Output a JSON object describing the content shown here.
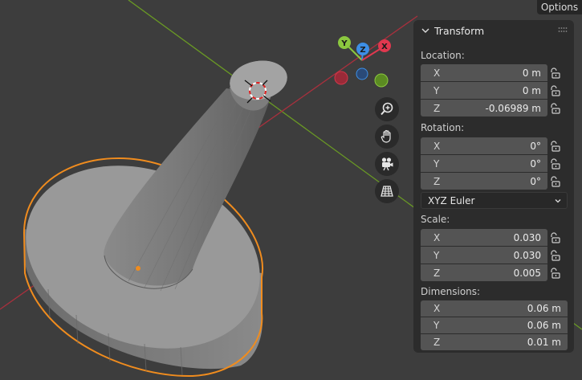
{
  "options_label": "Options",
  "gizmo": {
    "axes": [
      "Y",
      "Z",
      "X"
    ],
    "colors": {
      "x": "#e0384f",
      "y": "#8bc83f",
      "z": "#3d8fe6"
    }
  },
  "nav_icons": [
    "zoom-icon",
    "hand-pan-icon",
    "camera-icon",
    "grid-perspective-icon"
  ],
  "panel": {
    "title": "Transform",
    "location": {
      "label": "Location:",
      "rows": [
        {
          "axis": "X",
          "value": "0 m"
        },
        {
          "axis": "Y",
          "value": "0 m"
        },
        {
          "axis": "Z",
          "value": "-0.06989 m"
        }
      ]
    },
    "rotation": {
      "label": "Rotation:",
      "rows": [
        {
          "axis": "X",
          "value": "0°"
        },
        {
          "axis": "Y",
          "value": "0°"
        },
        {
          "axis": "Z",
          "value": "0°"
        }
      ],
      "mode": "XYZ Euler"
    },
    "scale": {
      "label": "Scale:",
      "rows": [
        {
          "axis": "X",
          "value": "0.030"
        },
        {
          "axis": "Y",
          "value": "0.030"
        },
        {
          "axis": "Z",
          "value": "0.005"
        }
      ]
    },
    "dimensions": {
      "label": "Dimensions:",
      "rows": [
        {
          "axis": "X",
          "value": "0.06 m"
        },
        {
          "axis": "Y",
          "value": "0.06 m"
        },
        {
          "axis": "Z",
          "value": "0.01 m"
        }
      ]
    }
  },
  "colors": {
    "viewport_bg": "#3d3d3d",
    "x_axis_line": "#a8303d",
    "y_axis_line": "#6a9a24",
    "selection_outline": "#f08c1e"
  }
}
